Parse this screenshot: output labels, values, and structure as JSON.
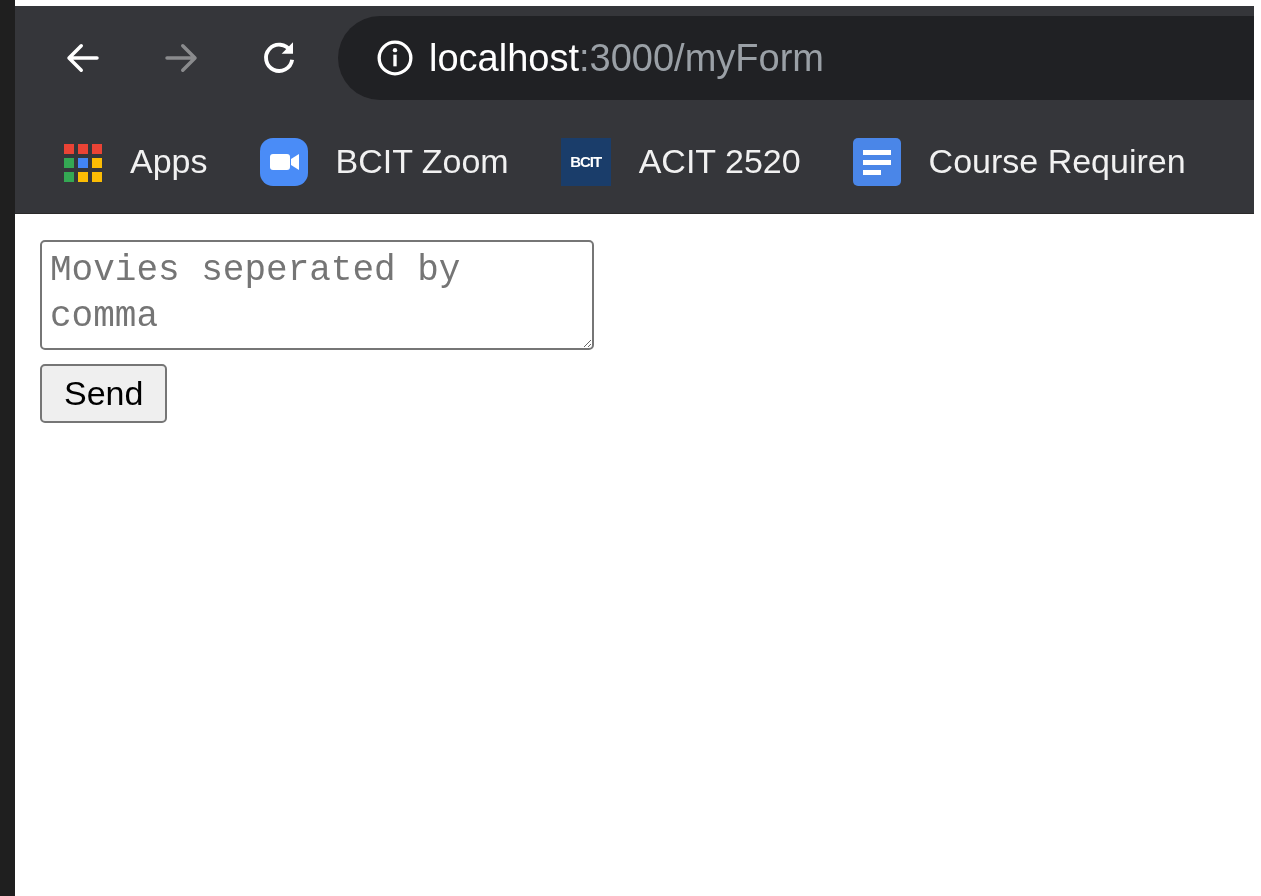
{
  "toolbar": {
    "buttons": [
      {
        "kind": "back",
        "disabled": false
      },
      {
        "kind": "forward",
        "disabled": true
      },
      {
        "kind": "reload",
        "disabled": false
      }
    ],
    "address": {
      "host": "localhost",
      "path": ":3000/myForm"
    }
  },
  "bookmarks": [
    {
      "kind": "apps",
      "label": "Apps"
    },
    {
      "kind": "video",
      "label": "BCIT Zoom"
    },
    {
      "kind": "badge",
      "badge": "BCIT",
      "label": "ACIT 2520"
    },
    {
      "kind": "doc",
      "label": "Course Requiren"
    }
  ],
  "form": {
    "textarea": {
      "placeholder": "Movies seperated by comma"
    },
    "submit": {
      "label": "Send"
    }
  }
}
